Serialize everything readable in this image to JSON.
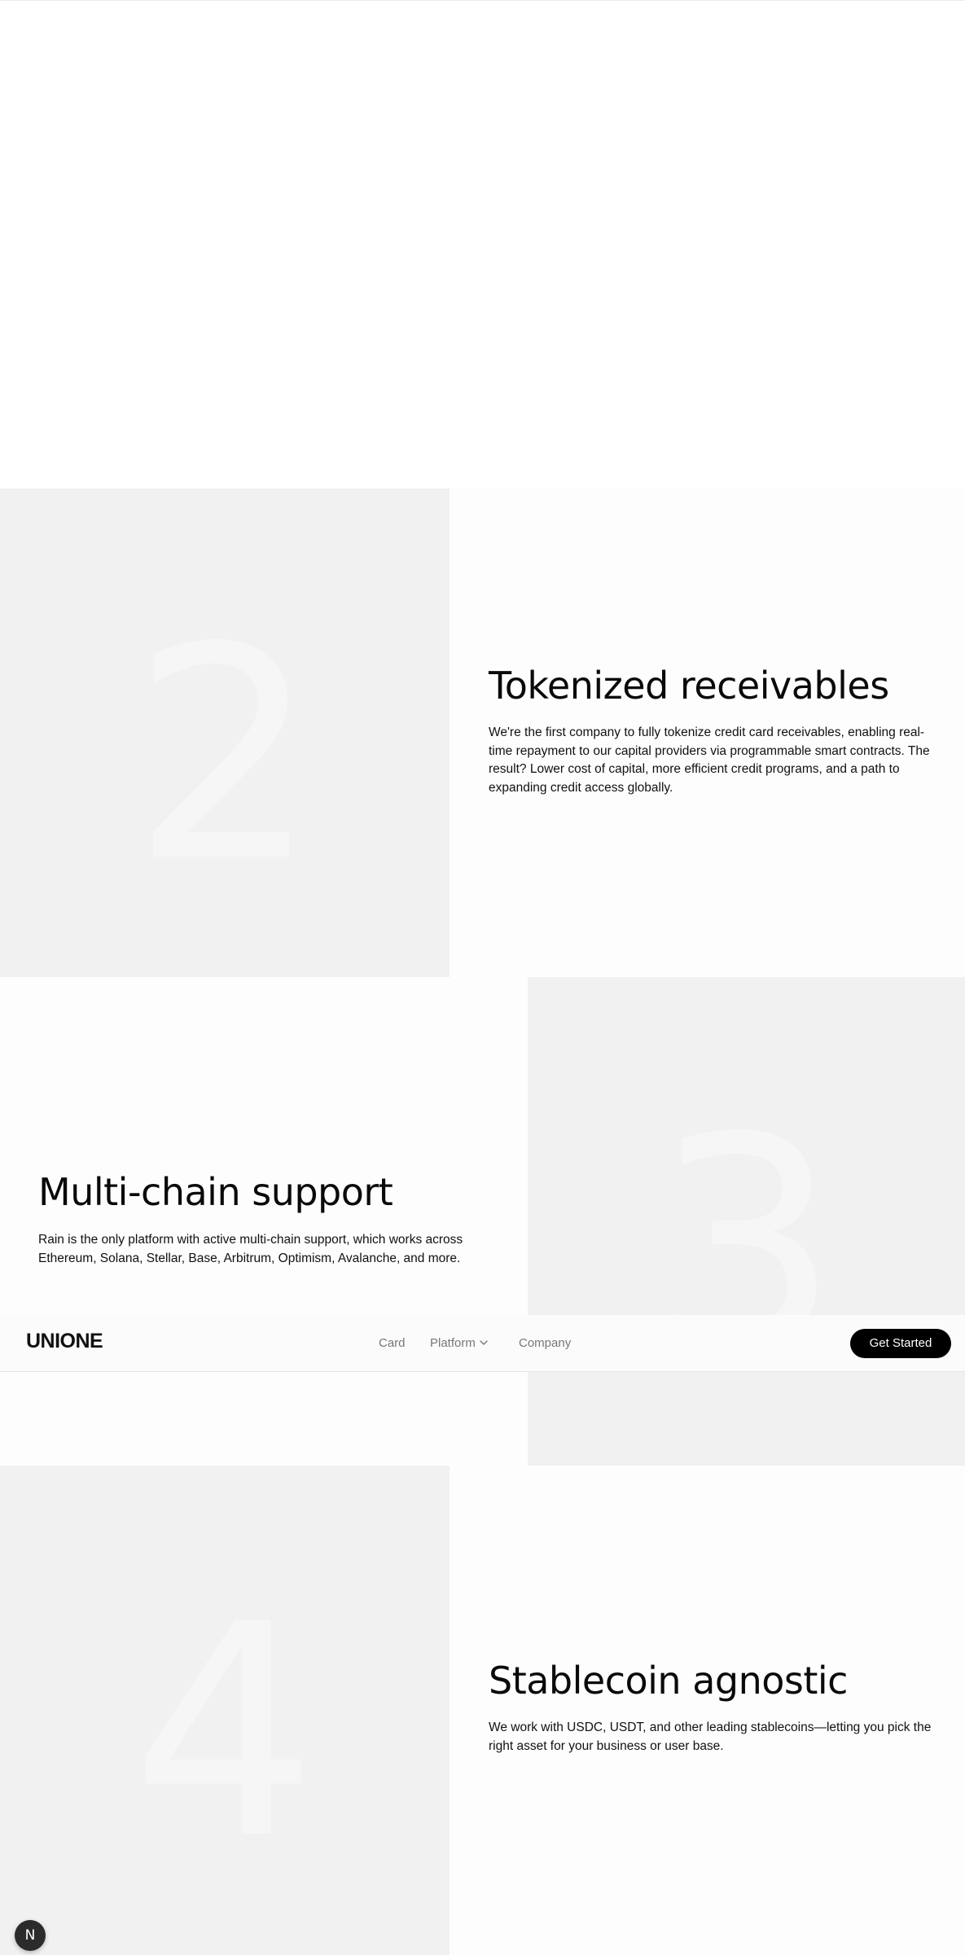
{
  "header": {
    "logo": "UNIONE",
    "nav": [
      {
        "label": "Card"
      },
      {
        "label": "Platform",
        "has_dropdown": true
      },
      {
        "label": "Company"
      }
    ],
    "cta_label": "Get Started"
  },
  "features": [
    {
      "number": "2",
      "title": "Tokenized receivables",
      "body": "We're the first company to fully tokenize credit card receivables, enabling real-time repayment to our capital providers via programmable smart contracts. The result? Lower cost of capital, more efficient credit programs, and a path to expanding credit access globally."
    },
    {
      "number": "3",
      "title": "Multi-chain support",
      "body": "Rain is the only platform with active multi-chain support, which works across Ethereum, Solana, Stellar, Base, Arbitrum, Optimism, Avalanche, and more."
    },
    {
      "number": "4",
      "title": "Stablecoin agnostic",
      "body": "We work with USDC, USDT, and other leading stablecoins—letting you pick the right asset for your business or user base."
    }
  ],
  "dev_badge": {
    "label": "N",
    "icon": "nextjs-icon"
  },
  "colors": {
    "panel_gray": "#f1f1f1",
    "digit_gray": "#f6f6f6",
    "cta_bg": "#000000",
    "cta_text": "#ffffff",
    "nav_text": "#777777"
  }
}
